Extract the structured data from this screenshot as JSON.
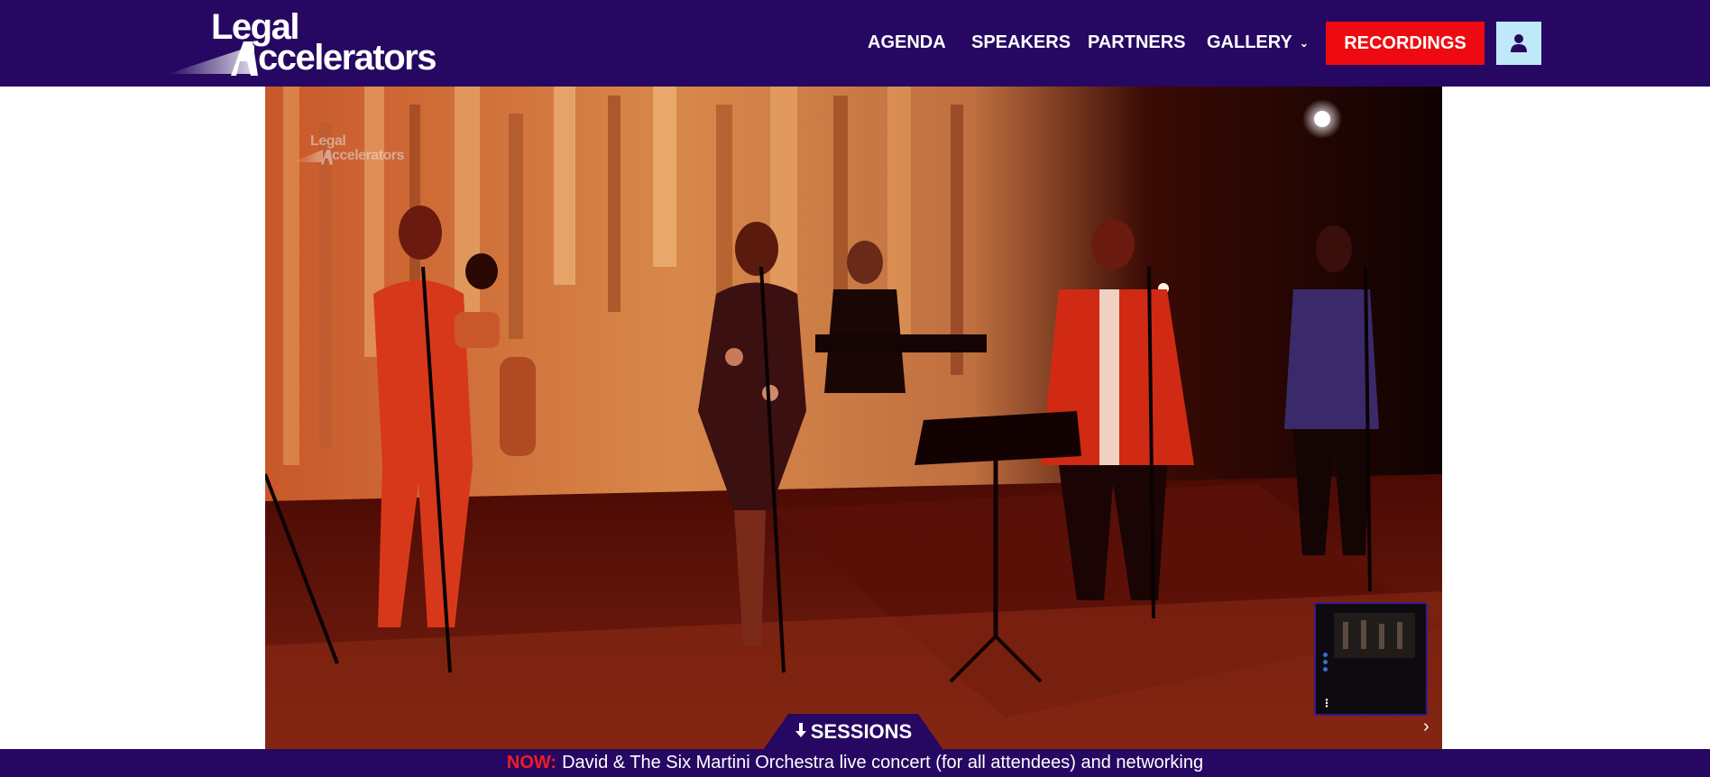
{
  "logo": {
    "line1": "Legal",
    "line2": "ccelerators"
  },
  "nav": {
    "items": [
      {
        "label": "AGENDA"
      },
      {
        "label": "SPEAKERS"
      },
      {
        "label": "PARTNERS"
      },
      {
        "label": "GALLERY"
      }
    ],
    "gallery_chevron": "⌄",
    "recordings_label": "RECORDINGS",
    "user_icon": "user-icon"
  },
  "video": {
    "watermark": {
      "line1": "Legal",
      "line2": "ccelerators"
    },
    "pip_menu": "⋮",
    "next_arrow": "›"
  },
  "sessions": {
    "arrow": "🡣",
    "label": "SESSIONS"
  },
  "ticker": {
    "now_label": "NOW:",
    "text": "David & The Six Martini Orchestra live concert (for all attendees) and networking"
  },
  "colors": {
    "brand_purple": "#260863",
    "accent_red": "#ee0a10",
    "user_button_bg": "#bfe9f8"
  }
}
